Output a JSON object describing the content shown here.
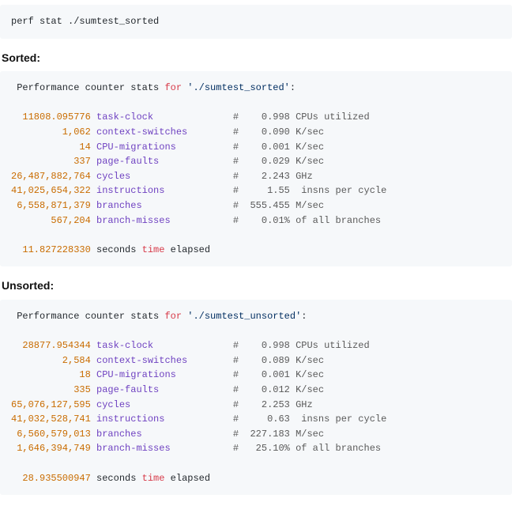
{
  "command": {
    "text": "perf stat ./sumtest_sorted"
  },
  "sections": {
    "sorted": {
      "heading": "Sorted:",
      "header_prefix": " Performance counter stats ",
      "header_kw": "for",
      "header_path": " './sumtest_sorted'",
      "header_suffix": ":",
      "rows": [
        {
          "value": "11808.095776",
          "metric": "task-clock",
          "rhs": "0.998 CPUs utilized"
        },
        {
          "value": "1,062",
          "metric": "context-switches",
          "rhs": "0.090 K/sec"
        },
        {
          "value": "14",
          "metric": "CPU-migrations",
          "rhs": "0.001 K/sec"
        },
        {
          "value": "337",
          "metric": "page-faults",
          "rhs": "0.029 K/sec"
        },
        {
          "value": "26,487,882,764",
          "metric": "cycles",
          "rhs": "2.243 GHz"
        },
        {
          "value": "41,025,654,322",
          "metric": "instructions",
          "rhs": "1.55  insns per cycle"
        },
        {
          "value": "6,558,871,379",
          "metric": "branches",
          "rhs": "555.455 M/sec"
        },
        {
          "value": "567,204",
          "metric": "branch-misses",
          "rhs": " 0.01% of all branches"
        }
      ],
      "footer": {
        "value": "11.827228330",
        "word1": "seconds",
        "kw": "time",
        "word2": "elapsed"
      }
    },
    "unsorted": {
      "heading": "Unsorted:",
      "header_prefix": " Performance counter stats ",
      "header_kw": "for",
      "header_path": " './sumtest_unsorted'",
      "header_suffix": ":",
      "rows": [
        {
          "value": "28877.954344",
          "metric": "task-clock",
          "rhs": "0.998 CPUs utilized"
        },
        {
          "value": "2,584",
          "metric": "context-switches",
          "rhs": "0.089 K/sec"
        },
        {
          "value": "18",
          "metric": "CPU-migrations",
          "rhs": "0.001 K/sec"
        },
        {
          "value": "335",
          "metric": "page-faults",
          "rhs": "0.012 K/sec"
        },
        {
          "value": "65,076,127,595",
          "metric": "cycles",
          "rhs": "2.253 GHz"
        },
        {
          "value": "41,032,528,741",
          "metric": "instructions",
          "rhs": "0.63  insns per cycle"
        },
        {
          "value": "6,560,579,013",
          "metric": "branches",
          "rhs": "227.183 M/sec"
        },
        {
          "value": "1,646,394,749",
          "metric": "branch-misses",
          "rhs": "25.10% of all branches"
        }
      ],
      "footer": {
        "value": "28.935500947",
        "word1": "seconds",
        "kw": "time",
        "word2": "elapsed"
      }
    }
  },
  "chart_data": {
    "type": "table",
    "title": "perf stat comparison",
    "series": [
      {
        "name": "sumtest_sorted",
        "metrics": {
          "task-clock": 11808.095776,
          "context-switches": 1062,
          "CPU-migrations": 14,
          "page-faults": 337,
          "cycles": 26487882764,
          "instructions": 41025654322,
          "branches": 6558871379,
          "branch-misses": 567204,
          "seconds-elapsed": 11.82722833,
          "CPUs-utilized": 0.998,
          "insns-per-cycle": 1.55,
          "branch-miss-pct": 0.01
        }
      },
      {
        "name": "sumtest_unsorted",
        "metrics": {
          "task-clock": 28877.954344,
          "context-switches": 2584,
          "CPU-migrations": 18,
          "page-faults": 335,
          "cycles": 65076127595,
          "instructions": 41032528741,
          "branches": 6560579013,
          "branch-misses": 1646394749,
          "seconds-elapsed": 28.935500947,
          "CPUs-utilized": 0.998,
          "insns-per-cycle": 0.63,
          "branch-miss-pct": 25.1
        }
      }
    ]
  }
}
